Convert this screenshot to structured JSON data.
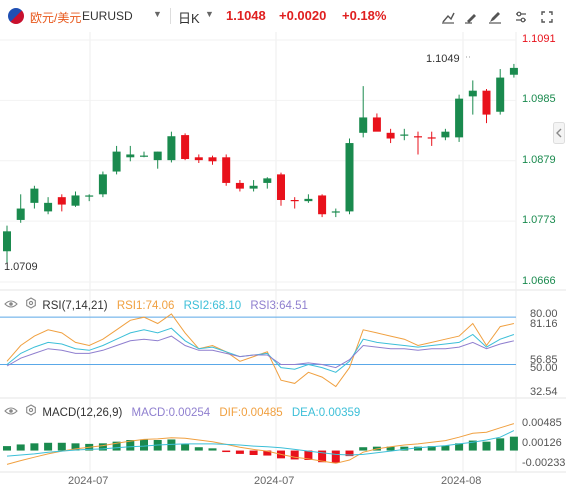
{
  "header": {
    "pair_cn": "欧元/美元",
    "pair_code": "EURUSD",
    "period": "日K",
    "price": "1.1048",
    "change": "+0.0020",
    "change_pct": "+0.18%"
  },
  "toolbar_icons": [
    "draw-icon",
    "drawing-tools-icon",
    "pen-icon",
    "settings-icon",
    "fullscreen-icon"
  ],
  "colors": {
    "up": "#1a8a4e",
    "down": "#e8111b",
    "accent": "#e8581c",
    "rsi1": "#f0a040",
    "rsi2": "#3cbfd8",
    "rsi3": "#8f7fcf",
    "macd": "#f0a040",
    "dif": "#f0a040",
    "dea": "#3cbfd8",
    "ref_line": "#5aa8e8"
  },
  "chart_data": [
    {
      "type": "candlestick",
      "name": "main",
      "y_ticks": [
        "1.1091",
        "1.0985",
        "1.0879",
        "1.0773",
        "1.0666"
      ],
      "ylim": [
        1.0666,
        1.1091
      ],
      "x_tick_labels": [
        "2024-07",
        "2024-07",
        "2024-08"
      ],
      "annotations": {
        "high_label": "1.1049",
        "low_label": "1.0709"
      },
      "candles": [
        {
          "o": 1.072,
          "h": 1.0765,
          "l": 1.07,
          "c": 1.0755
        },
        {
          "o": 1.0775,
          "h": 1.082,
          "l": 1.077,
          "c": 1.0795
        },
        {
          "o": 1.0805,
          "h": 1.0835,
          "l": 1.0795,
          "c": 1.083
        },
        {
          "o": 1.079,
          "h": 1.0815,
          "l": 1.0785,
          "c": 1.0805
        },
        {
          "o": 1.0815,
          "h": 1.082,
          "l": 1.079,
          "c": 1.0802
        },
        {
          "o": 1.08,
          "h": 1.0825,
          "l": 1.0798,
          "c": 1.0818
        },
        {
          "o": 1.0818,
          "h": 1.082,
          "l": 1.0808,
          "c": 1.0818
        },
        {
          "o": 1.082,
          "h": 1.086,
          "l": 1.0815,
          "c": 1.0855
        },
        {
          "o": 1.086,
          "h": 1.0905,
          "l": 1.0855,
          "c": 1.0895
        },
        {
          "o": 1.0885,
          "h": 1.0905,
          "l": 1.0878,
          "c": 1.089
        },
        {
          "o": 1.0888,
          "h": 1.0895,
          "l": 1.0885,
          "c": 1.0888
        },
        {
          "o": 1.088,
          "h": 1.0895,
          "l": 1.0865,
          "c": 1.0895
        },
        {
          "o": 1.088,
          "h": 1.093,
          "l": 1.0876,
          "c": 1.0922
        },
        {
          "o": 1.0924,
          "h": 1.0927,
          "l": 1.088,
          "c": 1.0882
        },
        {
          "o": 1.0885,
          "h": 1.089,
          "l": 1.0875,
          "c": 1.088
        },
        {
          "o": 1.0885,
          "h": 1.0888,
          "l": 1.0872,
          "c": 1.0878
        },
        {
          "o": 1.0885,
          "h": 1.089,
          "l": 1.0835,
          "c": 1.084
        },
        {
          "o": 1.084,
          "h": 1.0845,
          "l": 1.0825,
          "c": 1.083
        },
        {
          "o": 1.083,
          "h": 1.0845,
          "l": 1.0825,
          "c": 1.0835
        },
        {
          "o": 1.084,
          "h": 1.085,
          "l": 1.083,
          "c": 1.0848
        },
        {
          "o": 1.0855,
          "h": 1.0858,
          "l": 1.08,
          "c": 1.081
        },
        {
          "o": 1.081,
          "h": 1.0815,
          "l": 1.0795,
          "c": 1.0808
        },
        {
          "o": 1.0808,
          "h": 1.082,
          "l": 1.0805,
          "c": 1.0812
        },
        {
          "o": 1.0818,
          "h": 1.082,
          "l": 1.078,
          "c": 1.0785
        },
        {
          "o": 1.079,
          "h": 1.0795,
          "l": 1.078,
          "c": 1.079
        },
        {
          "o": 1.079,
          "h": 1.0918,
          "l": 1.0785,
          "c": 1.091
        },
        {
          "o": 1.0928,
          "h": 1.101,
          "l": 1.092,
          "c": 1.0955
        },
        {
          "o": 1.0955,
          "h": 1.0962,
          "l": 1.094,
          "c": 1.093
        },
        {
          "o": 1.0928,
          "h": 1.0935,
          "l": 1.091,
          "c": 1.0918
        },
        {
          "o": 1.0925,
          "h": 1.0935,
          "l": 1.0915,
          "c": 1.0925
        },
        {
          "o": 1.0922,
          "h": 1.093,
          "l": 1.089,
          "c": 1.092
        },
        {
          "o": 1.092,
          "h": 1.093,
          "l": 1.0905,
          "c": 1.0918
        },
        {
          "o": 1.092,
          "h": 1.0935,
          "l": 1.0915,
          "c": 1.093
        },
        {
          "o": 1.092,
          "h": 1.0995,
          "l": 1.0912,
          "c": 1.0988
        },
        {
          "o": 1.0992,
          "h": 1.102,
          "l": 1.096,
          "c": 1.1002
        },
        {
          "o": 1.1002,
          "h": 1.1005,
          "l": 1.0945,
          "c": 1.096
        },
        {
          "o": 1.0965,
          "h": 1.104,
          "l": 1.096,
          "c": 1.1025
        },
        {
          "o": 1.103,
          "h": 1.1049,
          "l": 1.1025,
          "c": 1.1042
        }
      ]
    },
    {
      "type": "line",
      "name": "rsi",
      "title": "RSI(7,14,21)",
      "legend": [
        {
          "name": "RSI1",
          "value": "74.06"
        },
        {
          "name": "RSI2",
          "value": "68.10"
        },
        {
          "name": "RSI3",
          "value": "64.51"
        }
      ],
      "y_ticks": [
        "80.00",
        "81.16",
        "56.85",
        "50.00",
        "32.54"
      ],
      "ref_lines": [
        80,
        50
      ],
      "ylim": [
        30,
        82
      ],
      "series": [
        {
          "name": "RSI1",
          "values": [
            52,
            62,
            68,
            72,
            70,
            64,
            62,
            66,
            72,
            78,
            80,
            76,
            82,
            70,
            60,
            62,
            58,
            52,
            55,
            58,
            40,
            38,
            45,
            42,
            36,
            48,
            72,
            70,
            68,
            66,
            62,
            64,
            66,
            68,
            76,
            62,
            74,
            76
          ]
        },
        {
          "name": "RSI2",
          "values": [
            50,
            57,
            61,
            64,
            63,
            60,
            59,
            62,
            66,
            70,
            72,
            70,
            73,
            65,
            60,
            61,
            58,
            55,
            56,
            57,
            48,
            47,
            50,
            48,
            45,
            52,
            66,
            64,
            63,
            62,
            61,
            62,
            63,
            64,
            69,
            61,
            66,
            69
          ]
        },
        {
          "name": "RSI3",
          "values": [
            49,
            54,
            57,
            60,
            59,
            57,
            57,
            59,
            62,
            65,
            66,
            65,
            68,
            62,
            59,
            59,
            57,
            55,
            56,
            56,
            50,
            50,
            51,
            50,
            48,
            53,
            62,
            61,
            60,
            60,
            59,
            60,
            60,
            61,
            64,
            60,
            63,
            65
          ]
        }
      ]
    },
    {
      "type": "bar",
      "name": "macd",
      "title": "MACD(12,26,9)",
      "legend": [
        {
          "name": "MACD",
          "value": "0.00254"
        },
        {
          "name": "DIF",
          "value": "0.00485"
        },
        {
          "name": "DEA",
          "value": "0.00359"
        }
      ],
      "y_ticks": [
        "0.00485",
        "0.00126",
        "-0.00233"
      ],
      "ylim": [
        -0.0035,
        0.0055
      ],
      "series": [
        {
          "name": "MACD",
          "values": [
            0.0008,
            0.0011,
            0.0013,
            0.0014,
            0.0014,
            0.0013,
            0.0012,
            0.0013,
            0.0016,
            0.0019,
            0.002,
            0.0019,
            0.002,
            0.0012,
            0.0006,
            0.0004,
            -0.0002,
            -0.0006,
            -0.0008,
            -0.0009,
            -0.0014,
            -0.0016,
            -0.0017,
            -0.0021,
            -0.0022,
            -0.001,
            0.0006,
            0.0007,
            0.0007,
            0.0007,
            0.0007,
            0.0008,
            0.0009,
            0.0013,
            0.0018,
            0.0016,
            0.0022,
            0.0025
          ]
        },
        {
          "name": "DIF",
          "values": [
            -0.0025,
            -0.0018,
            -0.0012,
            -0.0006,
            -0.0001,
            0.0003,
            0.0006,
            0.0009,
            0.0013,
            0.0017,
            0.002,
            0.0021,
            0.0023,
            0.0022,
            0.0019,
            0.0016,
            0.0011,
            0.0006,
            0.0002,
            -0.0001,
            -0.0007,
            -0.0012,
            -0.0015,
            -0.0019,
            -0.0023,
            -0.0017,
            -0.0003,
            0.0003,
            0.0007,
            0.001,
            0.0012,
            0.0015,
            0.0018,
            0.0024,
            0.0031,
            0.0033,
            0.0041,
            0.00485
          ]
        },
        {
          "name": "DEA",
          "values": [
            -0.001,
            -0.0008,
            -0.0006,
            -0.0003,
            -0.0001,
            0.0001,
            0.0002,
            0.0003,
            0.0005,
            0.0007,
            0.0008,
            0.001,
            0.0011,
            0.0012,
            0.0012,
            0.0012,
            0.0011,
            0.001,
            0.0008,
            0.0007,
            0.0005,
            0.0002,
            -0.0001,
            -0.0004,
            -0.0007,
            -0.0008,
            -0.0007,
            -0.0004,
            -0.0001,
            0.0002,
            0.0005,
            0.0007,
            0.0009,
            0.0012,
            0.0015,
            0.0019,
            0.0024,
            0.00359
          ]
        }
      ]
    }
  ]
}
